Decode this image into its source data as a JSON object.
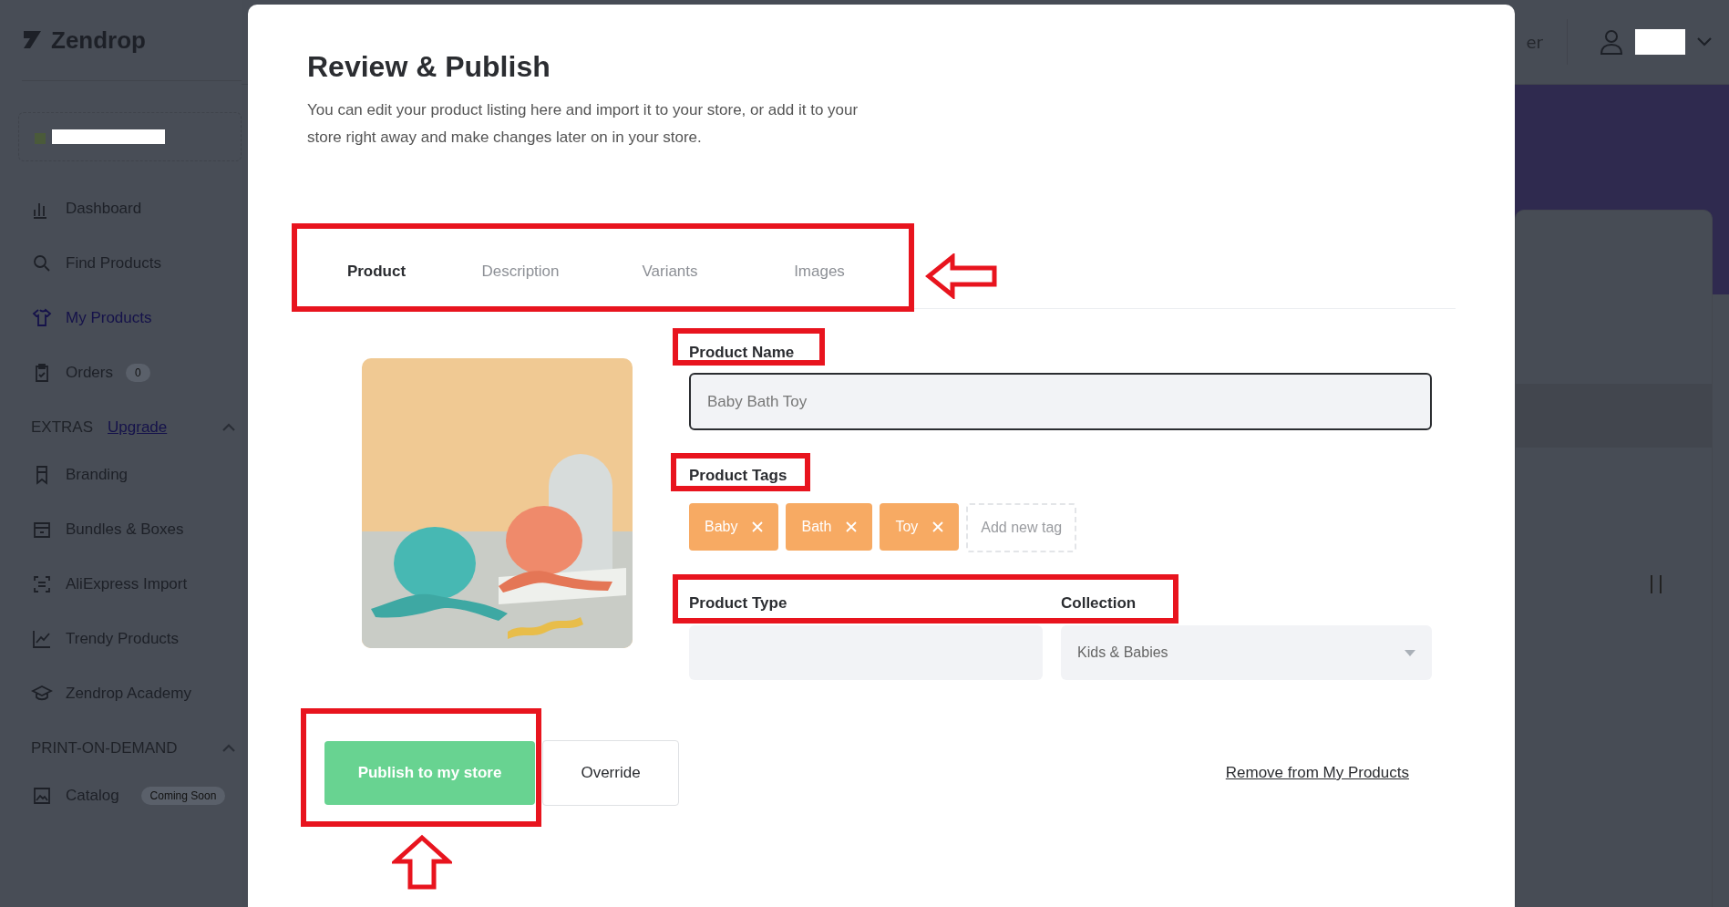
{
  "app": {
    "logo": "Zendrop"
  },
  "topbar": {
    "partial_text": "er"
  },
  "sidebar": {
    "items": [
      {
        "label": "Dashboard",
        "selected": false
      },
      {
        "label": "Find Products",
        "selected": false
      },
      {
        "label": "My Products",
        "selected": true
      },
      {
        "label": "Orders",
        "selected": false,
        "badge": "0"
      }
    ],
    "sections": [
      {
        "title": "EXTRAS",
        "link": "Upgrade",
        "expanded": true,
        "items": [
          {
            "label": "Branding",
            "selected": false
          },
          {
            "label": "Bundles & Boxes",
            "selected": false
          },
          {
            "label": "AliExpress Import",
            "selected": false
          },
          {
            "label": "Trendy Products",
            "selected": false
          },
          {
            "label": "Zendrop Academy",
            "selected": false
          }
        ]
      },
      {
        "title": "PRINT-ON-DEMAND",
        "expanded": true,
        "items": [
          {
            "label": "Catalog",
            "selected": false,
            "badge": "Coming Soon"
          }
        ]
      }
    ]
  },
  "modal": {
    "title": "Review & Publish",
    "description": "You can edit your product listing here and import it to your store, or add it to your store right away and make changes later on in your store.",
    "tabs": [
      {
        "label": "Product",
        "selected": true
      },
      {
        "label": "Description",
        "selected": false
      },
      {
        "label": "Variants",
        "selected": false
      },
      {
        "label": "Images",
        "selected": false
      }
    ],
    "product_name": {
      "label": "Product Name",
      "value": "Baby Bath Toy"
    },
    "product_tags": {
      "label": "Product Tags",
      "tags": [
        "Baby",
        "Bath",
        "Toy"
      ],
      "placeholder": "Add new tag"
    },
    "product_type": {
      "label": "Product Type"
    },
    "collection": {
      "label": "Collection",
      "value": "Kids & Babies"
    },
    "publish_button": {
      "label": "Publish to my store"
    },
    "override_button": {
      "label": "Override"
    },
    "remove_link": {
      "label": "Remove from My Products"
    }
  }
}
